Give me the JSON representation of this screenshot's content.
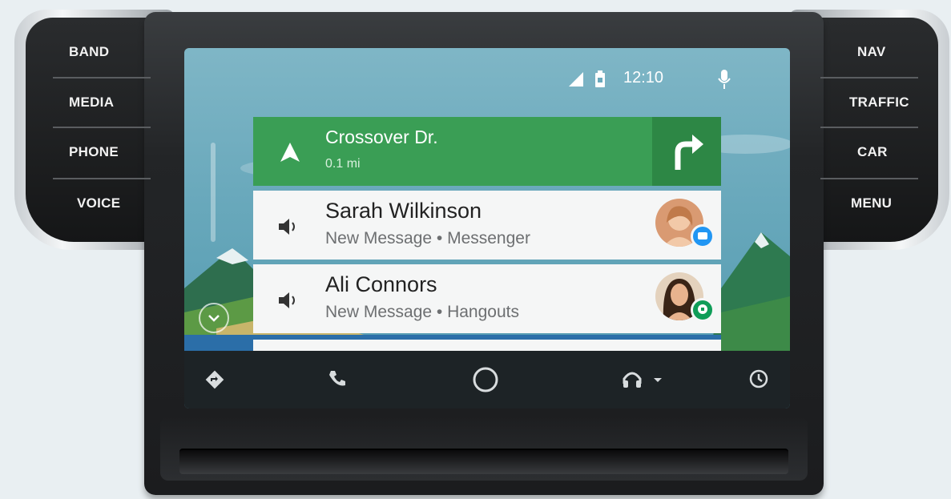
{
  "hardware": {
    "left_buttons": [
      "BAND",
      "MEDIA",
      "PHONE",
      "VOICE"
    ],
    "right_buttons": [
      "NAV",
      "TRAFFIC",
      "CAR",
      "MENU"
    ]
  },
  "status": {
    "time": "12:10",
    "icons": [
      "signal-icon",
      "battery-icon",
      "microphone-icon"
    ]
  },
  "navigation": {
    "street": "Crossover Dr.",
    "distance": "0.1 mi",
    "turn": "turn-right-icon"
  },
  "messages": [
    {
      "name": "Sarah Wilkinson",
      "subtitle": "New Message • Messenger",
      "app_icon": "messenger-icon",
      "badge_color": "#2196f3"
    },
    {
      "name": "Ali Connors",
      "subtitle": "New Message • Hangouts",
      "app_icon": "hangouts-icon",
      "badge_color": "#0f9d58"
    }
  ],
  "bottom_bar": [
    "directions-icon",
    "phone-icon",
    "home-circle-icon",
    "headphones-icon",
    "recents-icon"
  ],
  "colors": {
    "nav_green": "#3a9e55",
    "nav_green_dark": "#2d8745",
    "bottom_bar": "#1d2326"
  }
}
